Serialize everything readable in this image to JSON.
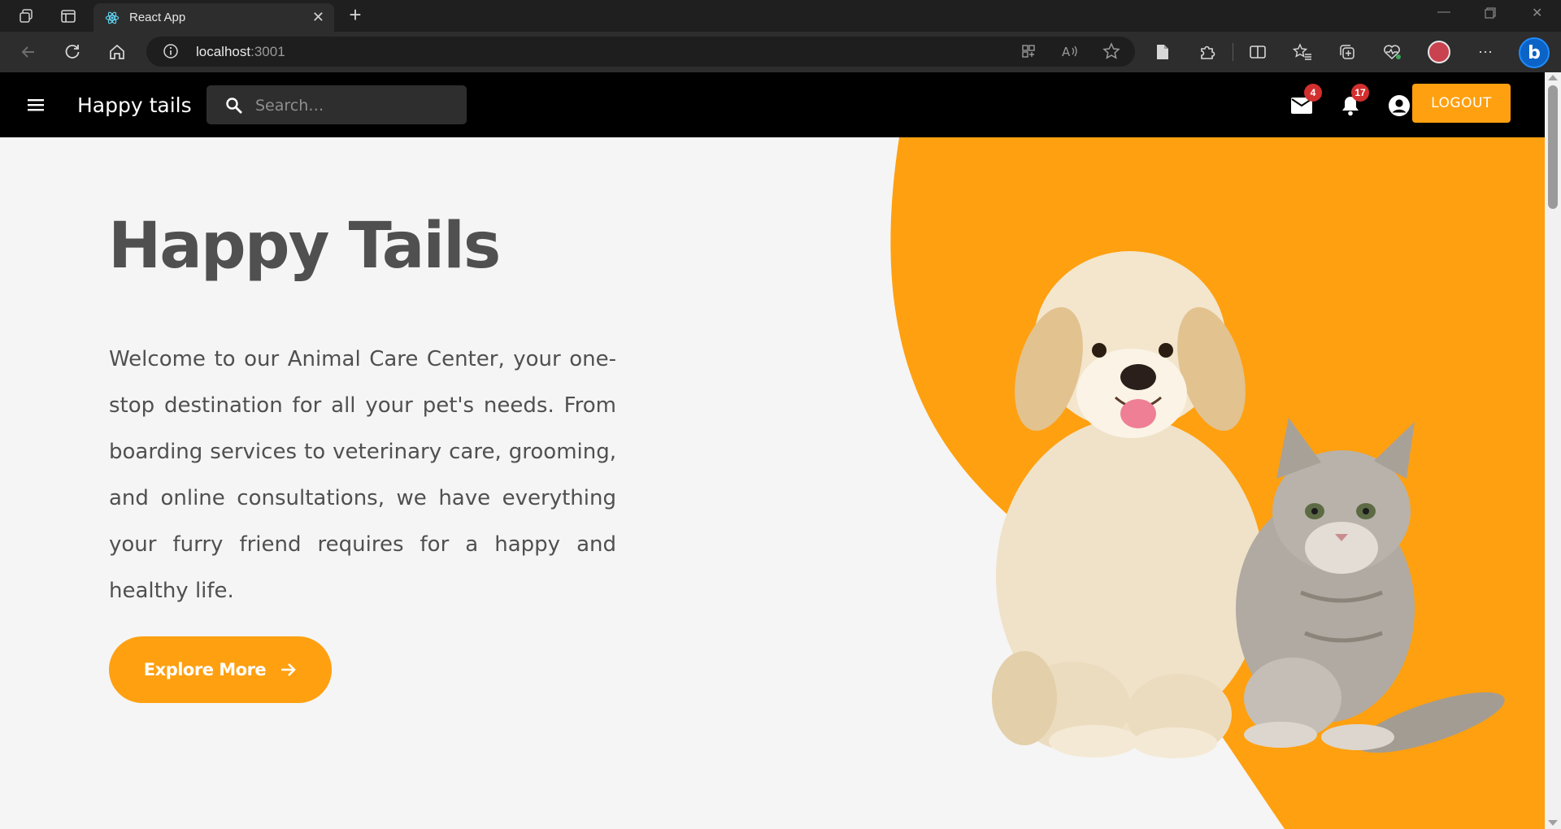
{
  "browser": {
    "tab_title": "React App",
    "url_host": "localhost",
    "url_port": ":3001"
  },
  "header": {
    "brand": "Happy tails",
    "search_placeholder": "Search…",
    "mail_count": "4",
    "notification_count": "17",
    "logout_label": "LOGOUT"
  },
  "hero": {
    "title": "Happy Tails",
    "description": "Welcome to our Animal Care Center, your one-stop destination for all your pet's needs. From boarding services to veterinary care, grooming, and online consultations, we have everything your furry friend requires for a happy and healthy life.",
    "cta_label": "Explore More"
  },
  "colors": {
    "accent": "#ffa010",
    "appbar": "#000000",
    "badge": "#d32f2f",
    "text": "#505050",
    "page_bg": "#f5f5f5"
  },
  "icons": {
    "header": [
      "menu-icon",
      "search-icon",
      "mail-icon",
      "bell-icon",
      "account-icon"
    ],
    "cta": "arrow-right-icon"
  }
}
